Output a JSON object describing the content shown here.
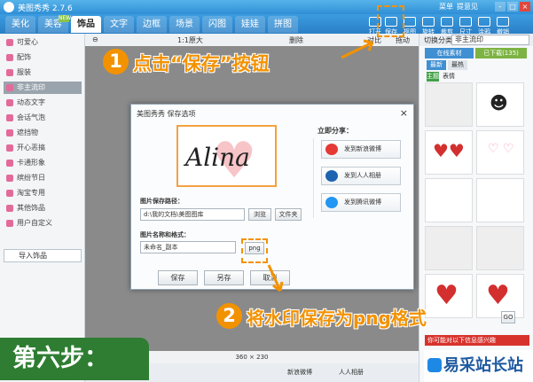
{
  "app": {
    "title": "美图秀秀 2.7.6",
    "menu_items": [
      "菜单",
      "提意见"
    ],
    "win_buttons": [
      "-",
      "□",
      "×"
    ]
  },
  "tabs": [
    "美化",
    "美容",
    "饰品",
    "文字",
    "边框",
    "场景",
    "闪图",
    "娃娃",
    "拼图"
  ],
  "active_tab": "饰品",
  "new_badge": "NEW",
  "toolbar": [
    "打开",
    "保存",
    "抠图",
    "旋转",
    "裁剪",
    "尺寸",
    "涂鸦",
    "撤销"
  ],
  "sidebar": {
    "items": [
      "可爱心",
      "配饰",
      "服装",
      "非主流印",
      "动态文字",
      "会话气泡",
      "遮挡物",
      "开心恶搞",
      "卡通形象",
      "缤纷节日",
      "淘宝专用",
      "其他饰品",
      "用户自定义"
    ],
    "active_index": 3,
    "import_button": "导入饰品"
  },
  "canvas": {
    "zoom": "1:1原大",
    "toolbar_items": [
      "删除",
      "对比",
      "拖动"
    ],
    "size": "360 × 230"
  },
  "bottombar": {
    "weibo": "新浪微博",
    "renren": "人人相册"
  },
  "right_panel": {
    "category_label": "切换分类",
    "category_value": "非主流印",
    "tabs": [
      "在线素材",
      "已下载(135)"
    ],
    "subtabs": [
      "最新",
      "最热"
    ],
    "subsub": [
      "主题",
      "表情"
    ],
    "go_button": "GO",
    "promo": "你可能对以下信息感兴趣"
  },
  "dialog": {
    "title": "美图秀秀 保存选项",
    "signature": "Alina",
    "path_label": "图片保存路径：",
    "path_value": "d:\\我的文档\\美图图库",
    "browse_button": "浏览",
    "folder_button": "文件夹",
    "name_label": "图片名称和格式：",
    "name_value": "未命名_副本",
    "format_value": "png",
    "share_label": "立即分享：",
    "share_buttons": [
      "发到新浪微博",
      "发到人人相册",
      "发到腾讯微博"
    ],
    "save_button": "保存",
    "saveas_button": "另存",
    "cancel_button": "取消"
  },
  "annotations": {
    "step1_num": "1",
    "step1_text": "点击“保存”按钮",
    "step2_num": "2",
    "step2_text": "将水印保存为png格式",
    "step_label": "第六步：",
    "watermark": "易采站长站"
  },
  "colors": {
    "accent": "#f39200",
    "app_blue": "#2f8fd6",
    "step_green": "#2e7d32"
  }
}
